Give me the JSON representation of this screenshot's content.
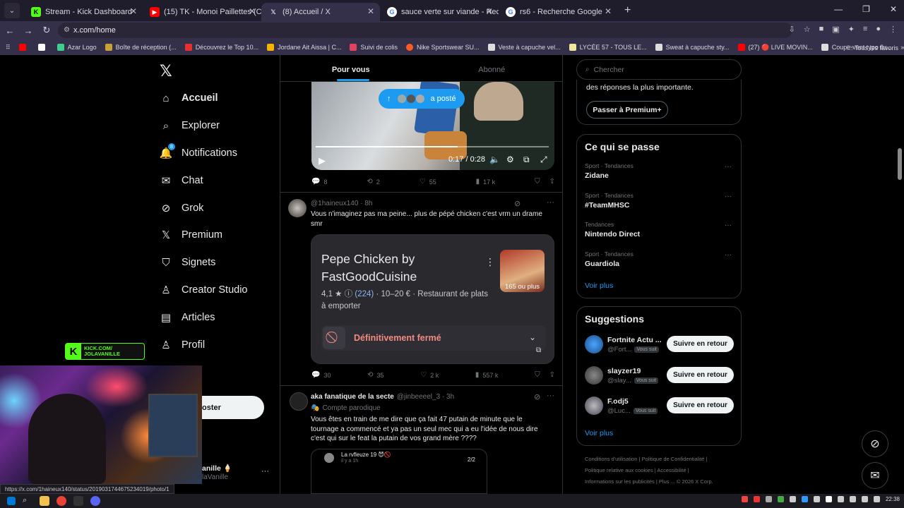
{
  "browser": {
    "tabs": [
      {
        "title": "Stream - Kick Dashboard",
        "icon": "kick-icon",
        "active": false
      },
      {
        "title": "(15) TK - Monoi Paillettes (Clip",
        "icon": "youtube-icon",
        "active": false
      },
      {
        "title": "(8) Accueil / X",
        "icon": "x-icon",
        "active": true
      },
      {
        "title": "sauce verte sur viande - Recher",
        "icon": "google-icon",
        "active": false
      },
      {
        "title": "rs6 - Recherche Google",
        "icon": "google-icon",
        "active": false
      }
    ],
    "address": "x.com/home",
    "bookmarks": [
      "Azar Logo",
      "Boîte de réception (...",
      "Découvrez le Top 10...",
      "Jordane Ait Aissa | C...",
      "Suivi de colis",
      "Nike Sportswear SU...",
      "Veste à capuche vel...",
      "LYCÉE 57 - TOUS LE...",
      "Sweat à capuche sty...",
      "(27) 🔴 LIVE MOVIN...",
      "Coupe-vent typo flu..."
    ],
    "bookmarks_all": "Tous les favoris",
    "status_url": "https://x.com/1haineux140/status/2019031744675234019/photo/1"
  },
  "nav": {
    "items": [
      {
        "label": "Accueil",
        "icon": "home-icon",
        "glyph": "⌂",
        "bold": true
      },
      {
        "label": "Explorer",
        "icon": "search-icon",
        "glyph": "⌕",
        "bold": false
      },
      {
        "label": "Notifications",
        "icon": "bell-icon",
        "glyph": "🔔",
        "bold": false
      },
      {
        "label": "Chat",
        "icon": "mail-icon",
        "glyph": "✉",
        "bold": false
      },
      {
        "label": "Grok",
        "icon": "grok-icon",
        "glyph": "⊘",
        "bold": false
      },
      {
        "label": "Premium",
        "icon": "x-logo-icon",
        "glyph": "𝕏",
        "bold": false
      },
      {
        "label": "Signets",
        "icon": "bookmark-icon",
        "glyph": "⛉",
        "bold": false
      },
      {
        "label": "Creator Studio",
        "icon": "creator-icon",
        "glyph": "♙",
        "bold": false
      },
      {
        "label": "Articles",
        "icon": "article-icon",
        "glyph": "▤",
        "bold": false
      },
      {
        "label": "Profil",
        "icon": "profile-icon",
        "glyph": "♙",
        "bold": false
      }
    ],
    "notif_count": "8",
    "post_button": "oster",
    "account_name": "anille 🍦",
    "account_handle": "laVanille"
  },
  "stream_overlay": {
    "kick_text_line1": "KICK.COM/",
    "kick_text_line2": "JOLAVANILLE"
  },
  "feed": {
    "tabs": [
      "Pour vous",
      "Abonné"
    ],
    "new_posts_pill": "a posté",
    "video": {
      "time": "0:17 / 0:28",
      "progress": 0.61
    },
    "post1_actions": {
      "replies": "8",
      "reposts": "2",
      "likes": "55",
      "views": "17 k"
    },
    "post2": {
      "handle": "@1haineux140 · 8h",
      "text": "Vous n'imaginez pas ma peine... plus de pépé chicken c'est vrm un drame smr",
      "card": {
        "title": "Pepe Chicken by FastGoodCuisine",
        "rating": "4,1 ★",
        "reviews": "(224)",
        "meta_rest": " · 10–20 € · Restaurant de plats à emporter",
        "photos_label": "165 ou plus",
        "closed": "Définitivement fermé"
      },
      "actions": {
        "replies": "30",
        "reposts": "35",
        "likes": "2 k",
        "views": "557 k"
      }
    },
    "post3": {
      "name": "aka fanatique de la secte",
      "handle": "@jinbeeeel_3 · 3h",
      "label": "Compte parodique",
      "text": "Vous êtes en train de me dire que ça fait 47 putain de minute que le tournage a commencé et ya pas un seul mec qui a eu l'idée de nous dire c'est qui sur le feat la putain de vos grand mère ????",
      "quote": {
        "name": "La rvfleuze 19 😈🚫",
        "sub": "il y a 1h",
        "page": "2/2"
      }
    }
  },
  "right": {
    "search_placeholder": "Chercher",
    "premium_text": "des réponses la plus importante.",
    "premium_button": "Passer à Premium+",
    "trends_title": "Ce qui se passe",
    "trends": [
      {
        "category": "Sport · Tendances",
        "name": "Zidane"
      },
      {
        "category": "Sport · Tendances",
        "name": "#TeamMHSC"
      },
      {
        "category": "Tendances",
        "name": "Nintendo Direct"
      },
      {
        "category": "Sport · Tendances",
        "name": "Guardiola"
      }
    ],
    "voir_plus": "Voir plus",
    "suggestions_title": "Suggestions",
    "suggestions": [
      {
        "name": "Fortnite Actu ...",
        "handle": "@Fort...",
        "badge": "Vous suit",
        "button": "Suivre en retour"
      },
      {
        "name": "slayzer19",
        "handle": "@slay...",
        "badge": "Vous suit",
        "button": "Suivre en retour"
      },
      {
        "name": "F.odj5",
        "handle": "@Luc...",
        "badge": "Vous suit",
        "button": "Suivre en retour"
      }
    ],
    "footer": {
      "line1": "Conditions d'utilisation  |  Politique de Confidentialité  |",
      "line2": "Politique relative aux cookies  |  Accessibilité  |",
      "line3": "Informations sur les publicités  |  Plus ...  © 2026 X Corp."
    }
  },
  "taskbar": {
    "time": "22:38"
  }
}
